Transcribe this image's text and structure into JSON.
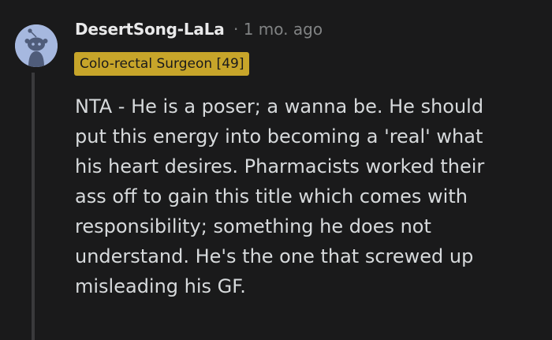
{
  "comment": {
    "author": "DesertSong-LaLa",
    "separator": "·",
    "timestamp": "1 mo. ago",
    "flair": "Colo-rectal Surgeon [49]",
    "body_lines": [
      "NTA - He is a poser; a wanna be. He should",
      "put this energy into becoming a 'real' what",
      "his heart desires. Pharmacists worked their",
      "ass off to gain this title which comes with",
      "responsibility; something he does not",
      "understand. He's the one that screwed up",
      "misleading his GF."
    ]
  },
  "colors": {
    "background": "#1a1a1b",
    "flair_background": "#c7a52a",
    "avatar_background": "#a6b8df",
    "thread_line": "#3a3a3c",
    "meta_text": "#818384"
  },
  "icons": {
    "avatar": "reddit-snoo-avatar-icon"
  }
}
